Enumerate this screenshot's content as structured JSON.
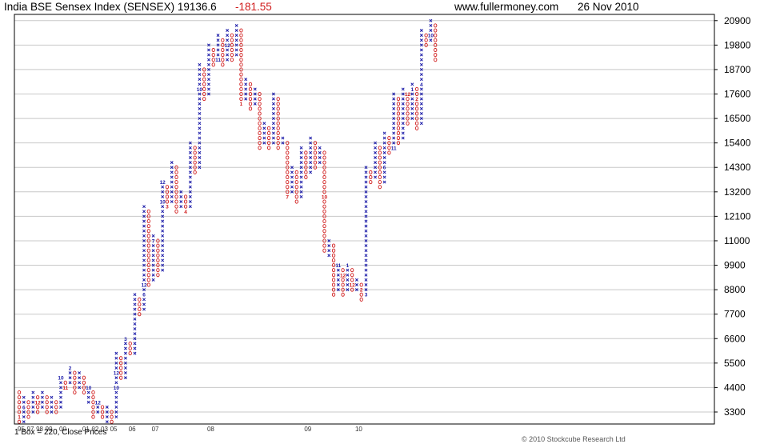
{
  "header": {
    "title": "India BSE Sensex Index (SENSEX) 19136.6",
    "change": "-181.55",
    "site": "www.fullermoney.com",
    "date": "26 Nov 2010"
  },
  "footer": {
    "box_info": "1 Box = 220, Close Prices",
    "copyright": "© 2010 Stockcube Research Ltd"
  },
  "colors": {
    "x_column": "#1a1aa8",
    "o_column": "#d01a1a",
    "grid": "#c8c8c8"
  },
  "chart_data": {
    "type": "point-and-figure",
    "box_size": 220,
    "price_basis": "Close Prices",
    "ylim": [
      2760,
      21180
    ],
    "y_ticks": [
      3300,
      4400,
      5500,
      6600,
      7700,
      8800,
      9900,
      11000,
      12100,
      13200,
      14300,
      15400,
      16500,
      17600,
      18700,
      19800,
      20900
    ],
    "x_tick_labels": [
      "95",
      "97",
      "98",
      "99",
      "00",
      "01",
      "02",
      "03",
      "05",
      "06",
      "07",
      "08",
      "09",
      "10"
    ],
    "x_tick_columns": [
      0,
      2,
      4,
      6,
      9,
      14,
      16,
      18,
      20,
      24,
      29,
      41,
      62,
      73
    ],
    "columns": [
      {
        "kind": "O",
        "top": 4180,
        "bottom": 2860
      },
      {
        "kind": "X",
        "top": 3960,
        "bottom": 2860
      },
      {
        "kind": "O",
        "top": 3740,
        "bottom": 3080
      },
      {
        "kind": "X",
        "top": 4180,
        "bottom": 3300
      },
      {
        "kind": "O",
        "top": 3960,
        "bottom": 3300
      },
      {
        "kind": "X",
        "top": 4180,
        "bottom": 3520
      },
      {
        "kind": "O",
        "top": 3960,
        "bottom": 3300
      },
      {
        "kind": "X",
        "top": 3960,
        "bottom": 3300
      },
      {
        "kind": "O",
        "top": 3740,
        "bottom": 3300
      },
      {
        "kind": "X",
        "top": 4840,
        "bottom": 3520
      },
      {
        "kind": "O",
        "top": 4620,
        "bottom": 4400
      },
      {
        "kind": "X",
        "top": 5280,
        "bottom": 4620
      },
      {
        "kind": "O",
        "top": 5060,
        "bottom": 4180
      },
      {
        "kind": "X",
        "top": 5060,
        "bottom": 4400
      },
      {
        "kind": "O",
        "top": 4840,
        "bottom": 4180
      },
      {
        "kind": "X",
        "top": 4400,
        "bottom": 3740
      },
      {
        "kind": "O",
        "top": 4180,
        "bottom": 3080
      },
      {
        "kind": "X",
        "top": 3740,
        "bottom": 3300
      },
      {
        "kind": "O",
        "top": 3520,
        "bottom": 3080
      },
      {
        "kind": "X",
        "top": 3520,
        "bottom": 2860
      },
      {
        "kind": "O",
        "top": 3300,
        "bottom": 2860
      },
      {
        "kind": "X",
        "top": 5940,
        "bottom": 3080
      },
      {
        "kind": "O",
        "top": 5720,
        "bottom": 4840
      },
      {
        "kind": "X",
        "top": 6600,
        "bottom": 4840
      },
      {
        "kind": "O",
        "top": 6380,
        "bottom": 5940
      },
      {
        "kind": "X",
        "top": 8580,
        "bottom": 5940
      },
      {
        "kind": "O",
        "top": 8360,
        "bottom": 7700
      },
      {
        "kind": "X",
        "top": 12540,
        "bottom": 7920
      },
      {
        "kind": "O",
        "top": 12320,
        "bottom": 9020
      },
      {
        "kind": "X",
        "top": 11220,
        "bottom": 9240
      },
      {
        "kind": "O",
        "top": 11000,
        "bottom": 9460
      },
      {
        "kind": "X",
        "top": 13640,
        "bottom": 9680
      },
      {
        "kind": "O",
        "top": 13420,
        "bottom": 12540
      },
      {
        "kind": "X",
        "top": 14520,
        "bottom": 12760
      },
      {
        "kind": "O",
        "top": 14300,
        "bottom": 12320
      },
      {
        "kind": "X",
        "top": 13200,
        "bottom": 12540
      },
      {
        "kind": "O",
        "top": 12980,
        "bottom": 12320
      },
      {
        "kind": "X",
        "top": 15400,
        "bottom": 12540
      },
      {
        "kind": "O",
        "top": 15180,
        "bottom": 14080
      },
      {
        "kind": "X",
        "top": 18920,
        "bottom": 14300
      },
      {
        "kind": "O",
        "top": 18700,
        "bottom": 17380
      },
      {
        "kind": "X",
        "top": 19800,
        "bottom": 17600
      },
      {
        "kind": "O",
        "top": 19580,
        "bottom": 18920
      },
      {
        "kind": "X",
        "top": 20240,
        "bottom": 19140
      },
      {
        "kind": "O",
        "top": 20020,
        "bottom": 18920
      },
      {
        "kind": "X",
        "top": 20460,
        "bottom": 19140
      },
      {
        "kind": "O",
        "top": 20240,
        "bottom": 19140
      },
      {
        "kind": "X",
        "top": 20680,
        "bottom": 19360
      },
      {
        "kind": "O",
        "top": 20460,
        "bottom": 17160
      },
      {
        "kind": "X",
        "top": 18260,
        "bottom": 17380
      },
      {
        "kind": "O",
        "top": 18040,
        "bottom": 16940
      },
      {
        "kind": "X",
        "top": 17820,
        "bottom": 17160
      },
      {
        "kind": "O",
        "top": 17600,
        "bottom": 15180
      },
      {
        "kind": "X",
        "top": 16280,
        "bottom": 15400
      },
      {
        "kind": "O",
        "top": 16060,
        "bottom": 15180
      },
      {
        "kind": "X",
        "top": 17600,
        "bottom": 15400
      },
      {
        "kind": "O",
        "top": 17380,
        "bottom": 15180
      },
      {
        "kind": "X",
        "top": 15620,
        "bottom": 15400
      },
      {
        "kind": "O",
        "top": 15400,
        "bottom": 12980
      },
      {
        "kind": "X",
        "top": 14300,
        "bottom": 13200
      },
      {
        "kind": "O",
        "top": 14080,
        "bottom": 12760
      },
      {
        "kind": "X",
        "top": 15180,
        "bottom": 12980
      },
      {
        "kind": "O",
        "top": 14960,
        "bottom": 13860
      },
      {
        "kind": "X",
        "top": 15620,
        "bottom": 14080
      },
      {
        "kind": "O",
        "top": 15400,
        "bottom": 14300
      },
      {
        "kind": "X",
        "top": 15180,
        "bottom": 14520
      },
      {
        "kind": "O",
        "top": 14960,
        "bottom": 10560
      },
      {
        "kind": "X",
        "top": 11000,
        "bottom": 10340
      },
      {
        "kind": "O",
        "top": 10780,
        "bottom": 8580
      },
      {
        "kind": "X",
        "top": 9900,
        "bottom": 8800
      },
      {
        "kind": "O",
        "top": 9680,
        "bottom": 8580
      },
      {
        "kind": "X",
        "top": 9900,
        "bottom": 8800
      },
      {
        "kind": "O",
        "top": 9680,
        "bottom": 8800
      },
      {
        "kind": "X",
        "top": 9240,
        "bottom": 8800
      },
      {
        "kind": "O",
        "top": 9020,
        "bottom": 8360
      },
      {
        "kind": "X",
        "top": 14300,
        "bottom": 8580
      },
      {
        "kind": "O",
        "top": 14080,
        "bottom": 13640
      },
      {
        "kind": "X",
        "top": 15400,
        "bottom": 13860
      },
      {
        "kind": "O",
        "top": 15180,
        "bottom": 13420
      },
      {
        "kind": "X",
        "top": 15840,
        "bottom": 13640
      },
      {
        "kind": "O",
        "top": 15620,
        "bottom": 14960
      },
      {
        "kind": "X",
        "top": 17600,
        "bottom": 15180
      },
      {
        "kind": "O",
        "top": 17380,
        "bottom": 15400
      },
      {
        "kind": "X",
        "top": 17820,
        "bottom": 15620
      },
      {
        "kind": "O",
        "top": 17600,
        "bottom": 16280
      },
      {
        "kind": "X",
        "top": 18040,
        "bottom": 16500
      },
      {
        "kind": "O",
        "top": 17820,
        "bottom": 16060
      },
      {
        "kind": "X",
        "top": 20460,
        "bottom": 16280
      },
      {
        "kind": "O",
        "top": 20240,
        "bottom": 19800
      },
      {
        "kind": "X",
        "top": 20900,
        "bottom": 20020
      },
      {
        "kind": "O",
        "top": 20680,
        "bottom": 19140
      }
    ],
    "month_markers": [
      {
        "col": 0,
        "price": 3080,
        "label": "1"
      },
      {
        "col": 1,
        "price": 3520,
        "label": "6"
      },
      {
        "col": 2,
        "price": 3960,
        "label": "12"
      },
      {
        "col": 4,
        "price": 3740,
        "label": "12"
      },
      {
        "col": 9,
        "price": 4840,
        "label": "10"
      },
      {
        "col": 10,
        "price": 4400,
        "label": "11"
      },
      {
        "col": 11,
        "price": 5280,
        "label": "2"
      },
      {
        "col": 15,
        "price": 4400,
        "label": "10"
      },
      {
        "col": 17,
        "price": 3740,
        "label": "12"
      },
      {
        "col": 21,
        "price": 4400,
        "label": "10"
      },
      {
        "col": 21,
        "price": 5060,
        "label": "12"
      },
      {
        "col": 23,
        "price": 6600,
        "label": "3"
      },
      {
        "col": 27,
        "price": 8580,
        "label": "6"
      },
      {
        "col": 27,
        "price": 9020,
        "label": "12"
      },
      {
        "col": 29,
        "price": 11000,
        "label": "7"
      },
      {
        "col": 31,
        "price": 13640,
        "label": "12"
      },
      {
        "col": 31,
        "price": 12760,
        "label": "10"
      },
      {
        "col": 32,
        "price": 12540,
        "label": "3"
      },
      {
        "col": 36,
        "price": 12320,
        "label": "4"
      },
      {
        "col": 39,
        "price": 17820,
        "label": "10"
      },
      {
        "col": 43,
        "price": 19140,
        "label": "11"
      },
      {
        "col": 45,
        "price": 19800,
        "label": "12"
      },
      {
        "col": 48,
        "price": 17160,
        "label": "1"
      },
      {
        "col": 51,
        "price": 16940,
        "label": "3"
      },
      {
        "col": 58,
        "price": 12980,
        "label": "7"
      },
      {
        "col": 66,
        "price": 12980,
        "label": "10"
      },
      {
        "col": 69,
        "price": 9900,
        "label": "11"
      },
      {
        "col": 70,
        "price": 9460,
        "label": "12"
      },
      {
        "col": 71,
        "price": 9900,
        "label": "1"
      },
      {
        "col": 72,
        "price": 9020,
        "label": "12"
      },
      {
        "col": 74,
        "price": 8800,
        "label": "2"
      },
      {
        "col": 75,
        "price": 8580,
        "label": "3"
      },
      {
        "col": 78,
        "price": 15620,
        "label": "9"
      },
      {
        "col": 79,
        "price": 14300,
        "label": "6"
      },
      {
        "col": 80,
        "price": 15840,
        "label": "6"
      },
      {
        "col": 81,
        "price": 15180,
        "label": "11"
      },
      {
        "col": 82,
        "price": 17600,
        "label": "10"
      },
      {
        "col": 84,
        "price": 17600,
        "label": "12"
      },
      {
        "col": 85,
        "price": 17820,
        "label": "1"
      },
      {
        "col": 86,
        "price": 17380,
        "label": "2"
      },
      {
        "col": 87,
        "price": 18040,
        "label": "4"
      },
      {
        "col": 89,
        "price": 20240,
        "label": "10"
      },
      {
        "col": 89,
        "price": 18700,
        "label": "5"
      },
      {
        "col": 91,
        "price": 20680,
        "label": "11"
      }
    ]
  }
}
